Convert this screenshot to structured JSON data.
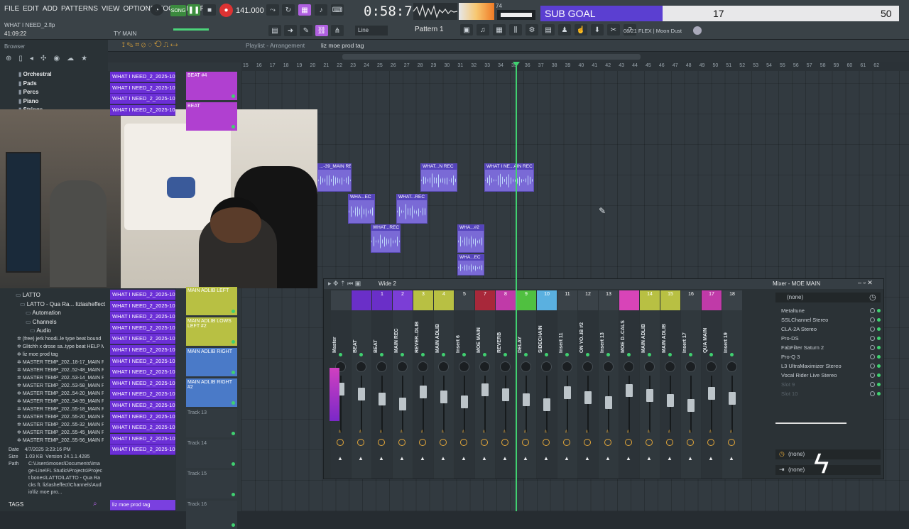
{
  "menu": [
    "FILE",
    "EDIT",
    "ADD",
    "PATTERNS",
    "VIEW",
    "OPTIONS",
    "TOOLS",
    "HELP"
  ],
  "transport": {
    "tempo": "141.000",
    "time": "0:58:70",
    "mode": "SONG",
    "cpu": "74"
  },
  "goal": {
    "label": "SUB GOAL",
    "current": "17",
    "target": "50",
    "progress": 0.34
  },
  "project": {
    "name": "WHAT I NEED_2.flp",
    "elapsed": "41:09:22",
    "channel": "TY MAIN"
  },
  "toolbar": {
    "snap": "Line",
    "pattern": "Pattern 1",
    "plugin_info": "08/21  FLEX | Moon Dust"
  },
  "browser": {
    "title": "Browser",
    "top_folders": [
      "Orchestral",
      "Pads",
      "Percs",
      "Piano",
      "Strings"
    ],
    "tree": [
      "LATTO",
      "LATTO - Qua Ra... lizlasheffect",
      "Automation",
      "Channels",
      "Audio"
    ],
    "files": [
      "(free) jerk hoodi..le type beat bound",
      "Glitchh x drose sa..type beat HELP ME",
      "liz moe prod tag",
      "MASTER TEMP_202..18-17_MAIN REC",
      "MASTER TEMP_202..52-48_MAIN REC",
      "MASTER TEMP_202..53-14_MAIN REC",
      "MASTER TEMP_202..53-58_MAIN REC",
      "MASTER TEMP_202..54-20_MAIN REC",
      "MASTER TEMP_202..54-39_MAIN REC",
      "MASTER TEMP_202..55-18_MAIN REC",
      "MASTER TEMP_202..55-20_MAIN REC",
      "MASTER TEMP_202..55-32_MAIN REC",
      "MASTER TEMP_202..55-45_MAIN REC",
      "MASTER TEMP_202..55-56_MAIN REC"
    ],
    "info": {
      "date_label": "Date",
      "date": "4/7/2025 3:23:16 PM",
      "size_label": "Size",
      "size": "1.03 KB",
      "version_label": "Version",
      "version": "24.1.1.4285",
      "path_label": "Path",
      "path": "C:\\Users\\moses\\Documents\\Image-Line\\FL Studio\\Projects\\Project bones\\LATTO\\LATTO - Qua Racks ft. lizlasheffect\\Channels\\Audio\\liz moe pro..."
    },
    "tags": "TAGS"
  },
  "playlist": {
    "title": "Playlist - Arrangement",
    "pattern": "liz moe prod tag",
    "ruler": [
      "15",
      "16",
      "17",
      "18",
      "19",
      "20",
      "21",
      "22",
      "23",
      "24",
      "25",
      "26",
      "27",
      "28",
      "29",
      "30",
      "31",
      "32",
      "33",
      "34",
      "35",
      "36",
      "37",
      "38",
      "39",
      "40",
      "41",
      "42",
      "43",
      "44",
      "45",
      "46",
      "47",
      "48",
      "49",
      "50",
      "51",
      "52",
      "53",
      "54",
      "55",
      "56",
      "57",
      "58",
      "59",
      "60",
      "61",
      "62"
    ],
    "clip_list": [
      "WHAT I NEED_2_2025-10...",
      "WHAT I NEED_2_2025-10...",
      "WHAT I NEED_2_2025-10...",
      "WHAT I NEED_2_2025-10...",
      "WHAT I NEED_2_2025-10...",
      "WHAT I NEED_2_2025-10...",
      "WHAT I NEED_2_2025-10...",
      "WHAT I NEED_2_2025-10...",
      "WHAT I NEED_2_2025-10...",
      "WHAT I NEED_2_2025-10...",
      "WHAT I NEED_2_2025-10...",
      "WHAT I NEED_2_2025-10...",
      "WHAT I NEED_2_2025-10...",
      "WHAT I NEED_2_2025-10...",
      "WHAT I NEED_2_2025-10...",
      "WHAT I NEED_2_2025-10...",
      "WHAT I NEED_2_2025-10...",
      "WHAT I NEED_2_2025-10...",
      "WHAT I NEED_2_2025-10...",
      "liz moe prod tag"
    ],
    "tracks": [
      "BEAT #4",
      "BEAT",
      "MAIN ADLIB LEFT",
      "MAIN ADLIB LOWS LEFT #2",
      "MAIN ADLIB RIGHT",
      "MAIN ADLIB RIGHT #2",
      "Track 13",
      "Track 14",
      "Track 15",
      "Track 16"
    ],
    "clips": [
      "...-39_MAIN REC",
      "WHAT...N REC",
      "WHAT I NE...AIN REC",
      "WHA...EC",
      "WHAT...REC",
      "WHAT...REC",
      "WHA...#2",
      "WHA...EC"
    ]
  },
  "mixer": {
    "title": "Mixer - MOE MAIN",
    "preset": "Wide 2",
    "slot_none": "(none)",
    "strips": [
      {
        "n": "",
        "name": "Master"
      },
      {
        "n": "",
        "name": "BEAT"
      },
      {
        "n": "1",
        "name": "BEAT"
      },
      {
        "n": "2",
        "name": "MAIN REC"
      },
      {
        "n": "3",
        "name": "REVER..DLIB"
      },
      {
        "n": "4",
        "name": "MAIN ADLIB"
      },
      {
        "n": "5",
        "name": "Insert 6"
      },
      {
        "n": "7",
        "name": "MOE MAIN"
      },
      {
        "n": "8",
        "name": "REVERB"
      },
      {
        "n": "9",
        "name": "DELAY"
      },
      {
        "n": "10",
        "name": "SIDECHAIN"
      },
      {
        "n": "11",
        "name": "Insert 11"
      },
      {
        "n": "12",
        "name": "ON YO..IB #2"
      },
      {
        "n": "13",
        "name": "Insert 13"
      },
      {
        "n": "",
        "name": "MOE D..CALS"
      },
      {
        "n": "14",
        "name": "MAIN ADLIB"
      },
      {
        "n": "15",
        "name": "MAIN ADLIB"
      },
      {
        "n": "16",
        "name": "Insert 17"
      },
      {
        "n": "17",
        "name": "QUA MAIN"
      },
      {
        "n": "18",
        "name": "Insert 19"
      }
    ],
    "strip_colors": [
      "#3a4248",
      "#6a2fc8",
      "#6a2fc8",
      "#7b3ed6",
      "#b8c043",
      "#b8c043",
      "#3a4248",
      "#a8283a",
      "#c03aa8",
      "#50c040",
      "#5ab0e0",
      "#3a4248",
      "#3a4248",
      "#3a4248",
      "#d844b8",
      "#b8c043",
      "#b8c043",
      "#3a4248",
      "#c03aa8",
      "#3a4248"
    ],
    "fx": [
      "Metaltune",
      "SSLChannel Stereo",
      "CLA-2A Stereo",
      "Pro-DS",
      "FabFilter Saturn 2",
      "Pro-Q 3",
      "L3 UltraMaximizer Stereo",
      "Vocal Rider Live Stereo",
      "Slot 9",
      "Slot 10"
    ],
    "send_none": "(none)"
  }
}
